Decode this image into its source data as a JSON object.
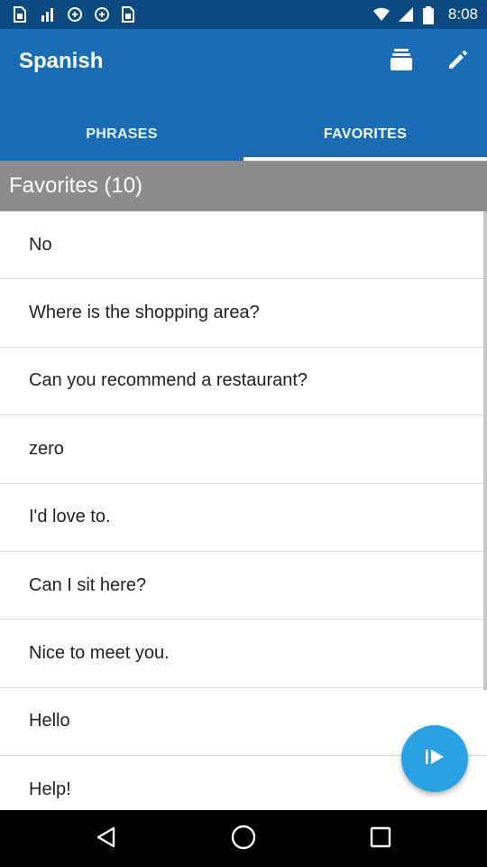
{
  "status_bar": {
    "time": "8:08",
    "left_icons": [
      "sim-card-icon",
      "signal-icon",
      "notification-icon",
      "notification-icon",
      "sim-card-icon"
    ],
    "right_icons": [
      "wifi-icon",
      "cellular-signal-icon",
      "battery-icon"
    ]
  },
  "app_bar": {
    "title": "Spanish",
    "color": "#1a6cb5",
    "actions": [
      "stack-icon",
      "edit-icon"
    ]
  },
  "tabs": [
    {
      "label": "PHRASES",
      "active": false
    },
    {
      "label": "FAVORITES",
      "active": true
    }
  ],
  "favorites": {
    "header": "Favorites (10)",
    "items": [
      {
        "text": "No"
      },
      {
        "text": "Where is the shopping area?"
      },
      {
        "text": "Can you recommend a restaurant?"
      },
      {
        "text": "zero"
      },
      {
        "text": "I'd love to."
      },
      {
        "text": "Can I sit here?"
      },
      {
        "text": "Nice to meet you."
      },
      {
        "text": "Hello"
      },
      {
        "text": "Help!"
      }
    ]
  },
  "fab": {
    "icon": "play-icon",
    "color": "#29a1e3"
  },
  "nav_bar": {
    "buttons": [
      "back-icon",
      "home-icon",
      "recent-apps-icon"
    ]
  }
}
